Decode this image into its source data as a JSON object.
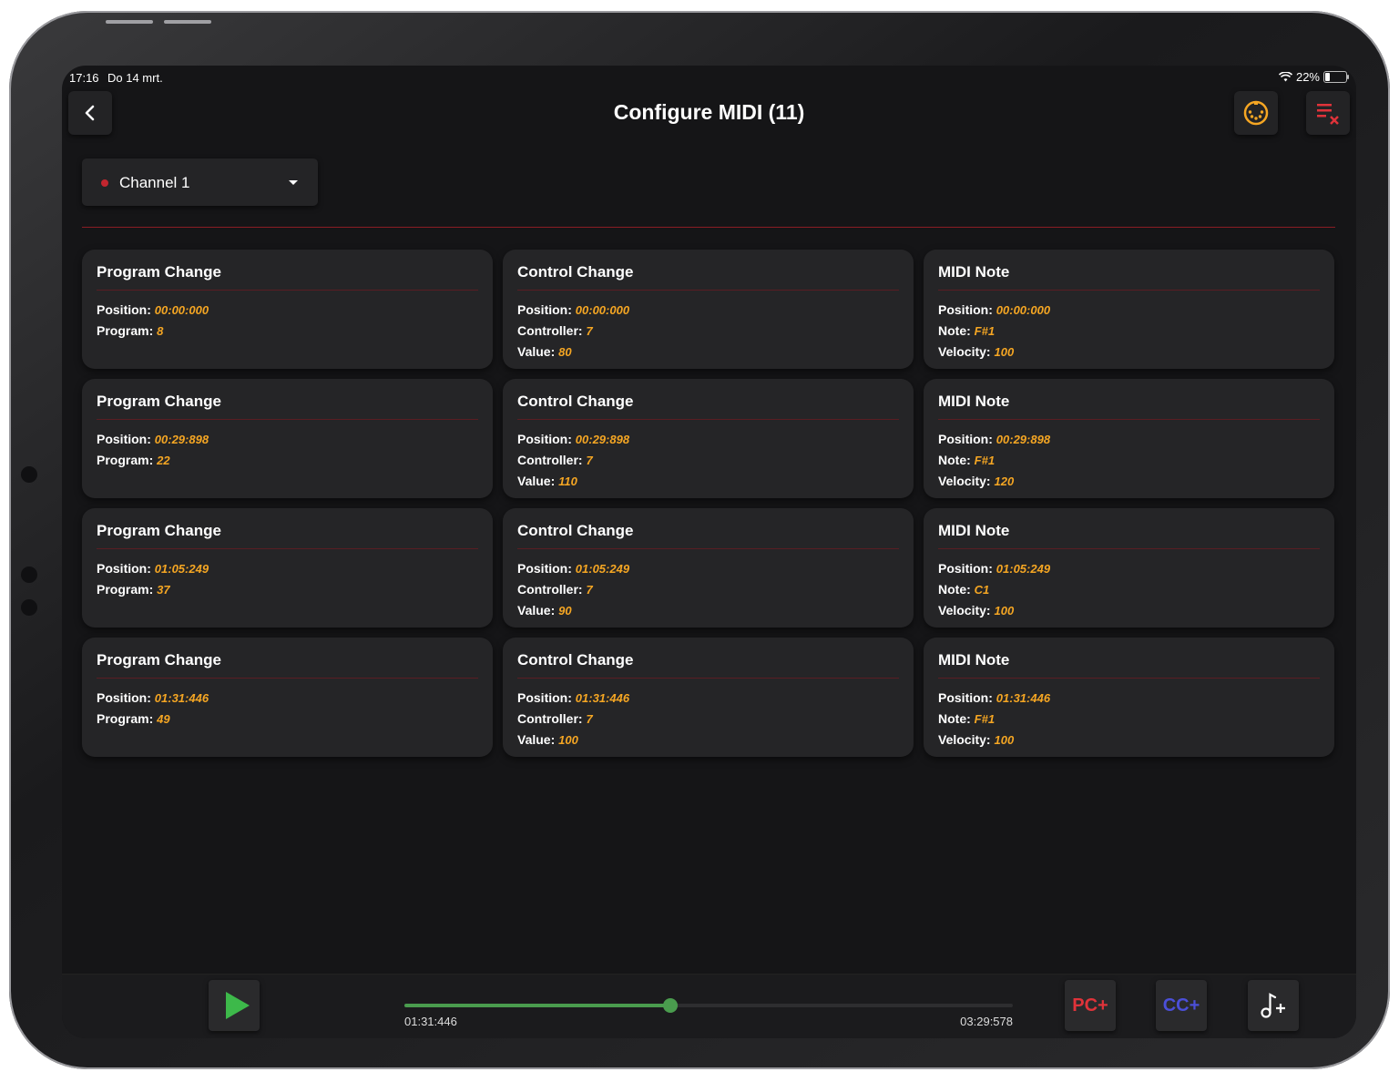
{
  "status_bar": {
    "time": "17:16",
    "date": "Do 14 mrt.",
    "battery": "22%",
    "battery_level": 0.22
  },
  "header": {
    "title": "Configure MIDI (11)",
    "back_icon": "chevron-left-icon",
    "right_icons": [
      "midi-connector-icon",
      "clear-list-icon"
    ]
  },
  "channel_select": {
    "selected": "Channel 1",
    "dot_color": "#c2262f"
  },
  "colors": {
    "accent": "#f5a623",
    "play": "#3db94a",
    "pc": "#e0333a",
    "cc": "#4b4fd8",
    "divider": "#8a1d24"
  },
  "events": [
    {
      "title": "Program Change",
      "rows": [
        {
          "label": "Position:",
          "value": "00:00:000"
        },
        {
          "label": "Program:",
          "value": "8"
        }
      ]
    },
    {
      "title": "Control Change",
      "rows": [
        {
          "label": "Position:",
          "value": "00:00:000"
        },
        {
          "label": "Controller:",
          "value": "7"
        },
        {
          "label": "Value:",
          "value": "80"
        }
      ]
    },
    {
      "title": "MIDI Note",
      "rows": [
        {
          "label": "Position:",
          "value": "00:00:000"
        },
        {
          "label": "Note:",
          "value": "F#1"
        },
        {
          "label": "Velocity:",
          "value": "100"
        }
      ]
    },
    {
      "title": "Program Change",
      "rows": [
        {
          "label": "Position:",
          "value": "00:29:898"
        },
        {
          "label": "Program:",
          "value": "22"
        }
      ]
    },
    {
      "title": "Control Change",
      "rows": [
        {
          "label": "Position:",
          "value": "00:29:898"
        },
        {
          "label": "Controller:",
          "value": "7"
        },
        {
          "label": "Value:",
          "value": "110"
        }
      ]
    },
    {
      "title": "MIDI Note",
      "rows": [
        {
          "label": "Position:",
          "value": "00:29:898"
        },
        {
          "label": "Note:",
          "value": "F#1"
        },
        {
          "label": "Velocity:",
          "value": "120"
        }
      ]
    },
    {
      "title": "Program Change",
      "rows": [
        {
          "label": "Position:",
          "value": "01:05:249"
        },
        {
          "label": "Program:",
          "value": "37"
        }
      ]
    },
    {
      "title": "Control Change",
      "rows": [
        {
          "label": "Position:",
          "value": "01:05:249"
        },
        {
          "label": "Controller:",
          "value": "7"
        },
        {
          "label": "Value:",
          "value": "90"
        }
      ]
    },
    {
      "title": "MIDI Note",
      "rows": [
        {
          "label": "Position:",
          "value": "01:05:249"
        },
        {
          "label": "Note:",
          "value": "C1"
        },
        {
          "label": "Velocity:",
          "value": "100"
        }
      ]
    },
    {
      "title": "Program Change",
      "rows": [
        {
          "label": "Position:",
          "value": "01:31:446"
        },
        {
          "label": "Program:",
          "value": "49"
        }
      ]
    },
    {
      "title": "Control Change",
      "rows": [
        {
          "label": "Position:",
          "value": "01:31:446"
        },
        {
          "label": "Controller:",
          "value": "7"
        },
        {
          "label": "Value:",
          "value": "100"
        }
      ]
    },
    {
      "title": "MIDI Note",
      "rows": [
        {
          "label": "Position:",
          "value": "01:31:446"
        },
        {
          "label": "Note:",
          "value": "F#1"
        },
        {
          "label": "Velocity:",
          "value": "100"
        }
      ]
    }
  ],
  "player": {
    "current": "01:31:446",
    "total": "03:29:578",
    "progress": 0.4366
  },
  "actions": {
    "pc_label": "PC+",
    "cc_label": "CC+",
    "note_icon": "add-note-icon"
  }
}
